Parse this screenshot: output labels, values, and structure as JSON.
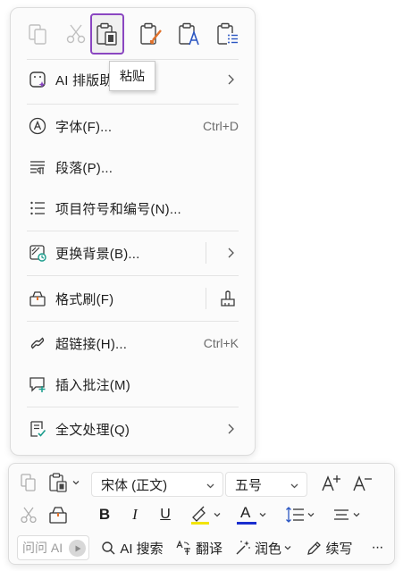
{
  "paste_options": [
    {
      "name": "copy-format",
      "state": "disabled"
    },
    {
      "name": "cut",
      "state": "disabled"
    },
    {
      "name": "paste",
      "state": "selected"
    },
    {
      "name": "paste-keep-formatting",
      "state": "normal"
    },
    {
      "name": "paste-text-only",
      "state": "normal"
    },
    {
      "name": "paste-list",
      "state": "normal"
    }
  ],
  "tooltip": "粘贴",
  "menu": {
    "ai_layout": "AI 排版助手",
    "font": "字体(F)...",
    "font_shortcut": "Ctrl+D",
    "paragraph": "段落(P)...",
    "bullets": "项目符号和编号(N)...",
    "background": "更换背景(B)...",
    "format_painter": "格式刷(F)",
    "hyperlink": "超链接(H)...",
    "hyperlink_shortcut": "Ctrl+K",
    "comment": "插入批注(M)",
    "full_text": "全文处理(Q)"
  },
  "toolbar": {
    "font_name": "宋体 (正文)",
    "font_size": "五号",
    "bold": "B",
    "italic": "I",
    "underline": "U",
    "font_color_letter": "A",
    "ask_placeholder": "问问 AI",
    "ai_search": "AI 搜索",
    "translate": "翻译",
    "polish": "润色",
    "continue_writing": "续写",
    "more": "···"
  },
  "colors": {
    "accent_purple": "#8a46c1",
    "highlight_yellow": "#f2e400",
    "font_color_blue": "#1a2fcf",
    "paint_orange": "#e0712b",
    "teal": "#1a9c8c"
  }
}
